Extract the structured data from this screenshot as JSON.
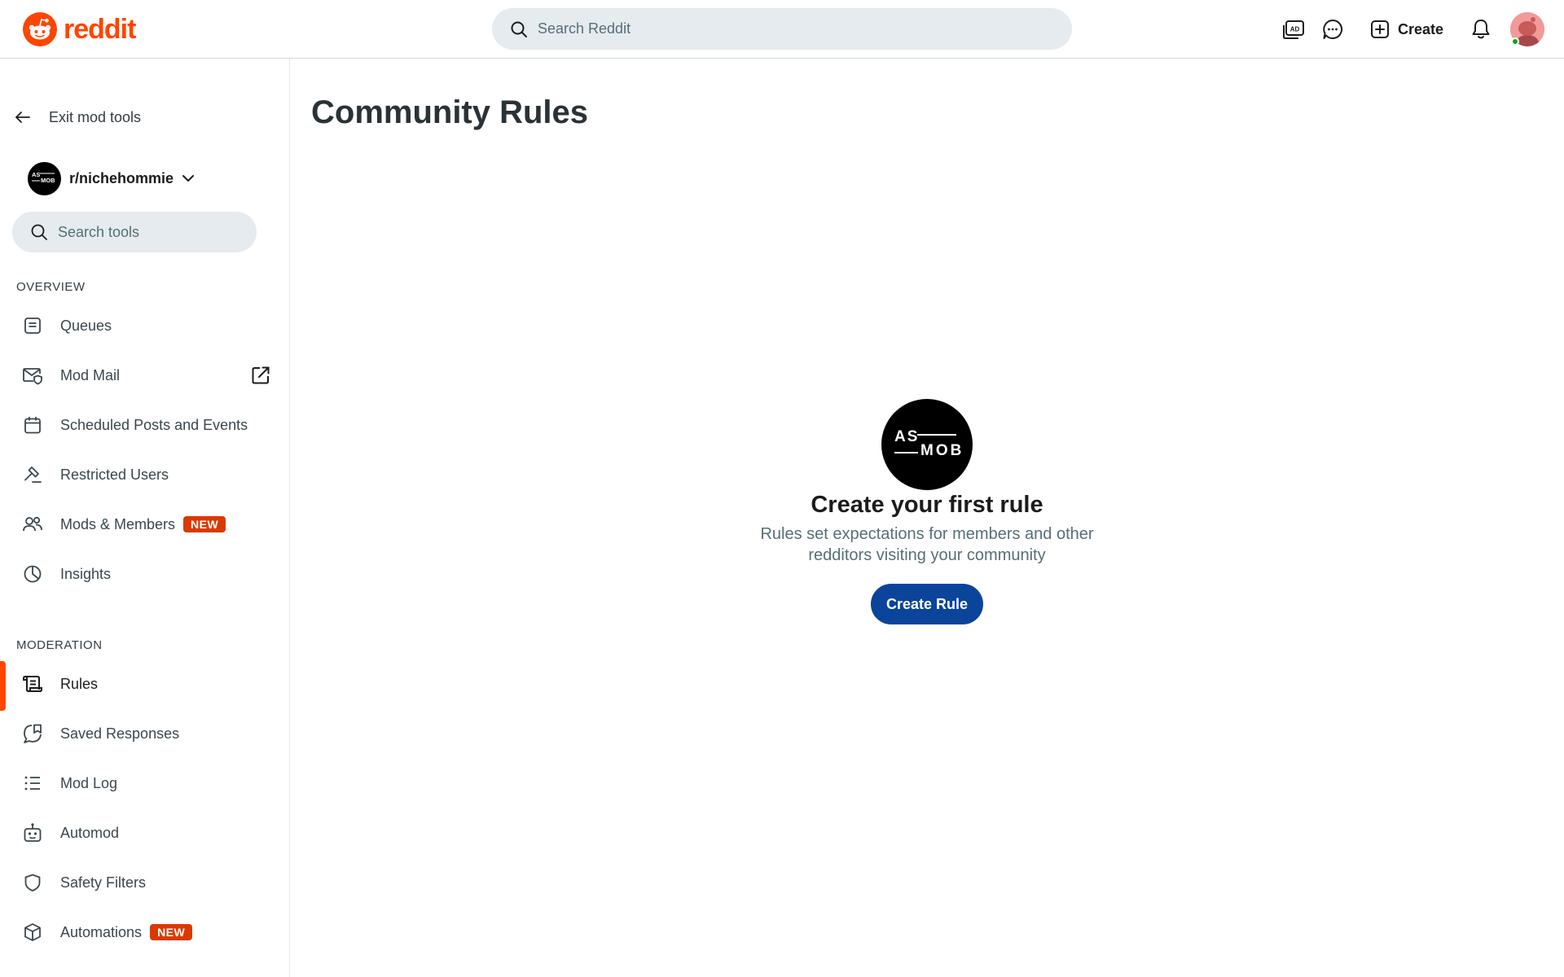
{
  "header": {
    "logo_text": "reddit",
    "search_placeholder": "Search Reddit",
    "create_label": "Create",
    "brand_color": "#ff4500"
  },
  "sidebar": {
    "exit_label": "Exit mod tools",
    "community_name": "r/nichehommie",
    "community_logo_text": "AS MOB",
    "search_placeholder": "Search tools",
    "sections": {
      "overview": "OVERVIEW",
      "moderation": "MODERATION"
    },
    "overview_items": [
      {
        "label": "Queues",
        "icon": "queue-icon"
      },
      {
        "label": "Mod Mail",
        "icon": "mod-mail-icon",
        "external": true
      },
      {
        "label": "Scheduled Posts and Events",
        "icon": "calendar-icon"
      },
      {
        "label": "Restricted Users",
        "icon": "hammer-icon"
      },
      {
        "label": "Mods & Members",
        "icon": "members-icon",
        "badge": "NEW"
      },
      {
        "label": "Insights",
        "icon": "pie-chart-icon"
      }
    ],
    "moderation_items": [
      {
        "label": "Rules",
        "icon": "rules-icon",
        "active": true
      },
      {
        "label": "Saved Responses",
        "icon": "saved-responses-icon"
      },
      {
        "label": "Mod Log",
        "icon": "list-icon"
      },
      {
        "label": "Automod",
        "icon": "bot-icon"
      },
      {
        "label": "Safety Filters",
        "icon": "shield-icon"
      },
      {
        "label": "Automations",
        "icon": "cube-icon",
        "badge": "NEW"
      }
    ]
  },
  "main": {
    "title": "Community Rules",
    "empty_title": "Create your first rule",
    "empty_description": "Rules set expectations for members and other redditors visiting your community",
    "create_rule_label": "Create Rule",
    "primary_button_color": "#0a449b"
  }
}
